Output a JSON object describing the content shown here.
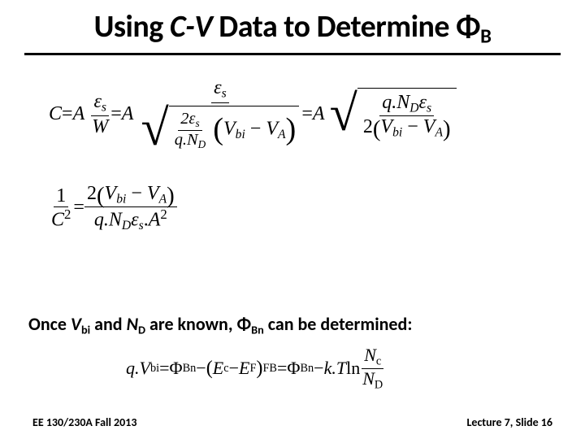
{
  "title": {
    "pre": "Using ",
    "cv": "C-V",
    "post": " Data to Determine Φ",
    "sub": "B"
  },
  "eq1": {
    "C": "C",
    "eq": " = ",
    "A": "A",
    "frac1_num": "ε",
    "frac1_num_sub": "s",
    "frac1_den": "W",
    "frac2_num": "ε",
    "frac2_num_sub": "s",
    "sqrt_inner_num": "2ε",
    "sqrt_inner_num_sub": "s",
    "sqrt_inner_den_pre": "q.N",
    "sqrt_inner_den_sub": "D",
    "paren_pre": "V",
    "paren_sub1": "bi",
    "minus": " − ",
    "paren_v2": "V",
    "paren_sub2": "A",
    "right_num_pre": "q.N",
    "right_num_sub1": "D",
    "right_num_eps": "ε",
    "right_num_sub2": "s",
    "right_den_2": "2",
    "right_den_v1": "V",
    "right_den_sub1": "bi",
    "right_den_v2": "V",
    "right_den_sub2": "A"
  },
  "eq2": {
    "lhs_num": "1",
    "lhs_den": "C",
    "lhs_sup": "2",
    "eq": " = ",
    "rhs_num_2": "2",
    "rhs_num_v1": "V",
    "rhs_num_sub1": "bi",
    "rhs_num_minus": " − ",
    "rhs_num_v2": "V",
    "rhs_num_sub2": "A",
    "rhs_den_pre": "q.N",
    "rhs_den_sub1": "D",
    "rhs_den_eps": "ε",
    "rhs_den_sub2": "s",
    "rhs_den_dot": ".",
    "rhs_den_A": "A",
    "rhs_den_sup": "2"
  },
  "stmt": {
    "pre": "Once ",
    "v": "V",
    "vsub": "bi",
    "and": " and ",
    "n": "N",
    "nsub": "D",
    "mid": " are known, Φ",
    "phisub": "Bn",
    "post": " can be determined:"
  },
  "eq3": {
    "qv": "q.V",
    "qvsub": "bi",
    "eq": " = ",
    "phi1": "Φ",
    "phi1sub": "Bn",
    "minus": " − ",
    "paren_e": "E",
    "paren_esub": "c",
    "paren_minus": " − ",
    "paren_ef": "E",
    "paren_efsub": "F",
    "fb": "FB",
    "eq2": " = ",
    "phi2": "Φ",
    "phi2sub": "Bn",
    "minus2": " − ",
    "kt": "k.T ",
    "ln": "ln ",
    "frac_num_n": "N",
    "frac_num_sub": "c",
    "frac_den_n": "N",
    "frac_den_sub": "D"
  },
  "footer": {
    "left": "EE 130/230A Fall 2013",
    "right": "Lecture 7, Slide 16"
  }
}
